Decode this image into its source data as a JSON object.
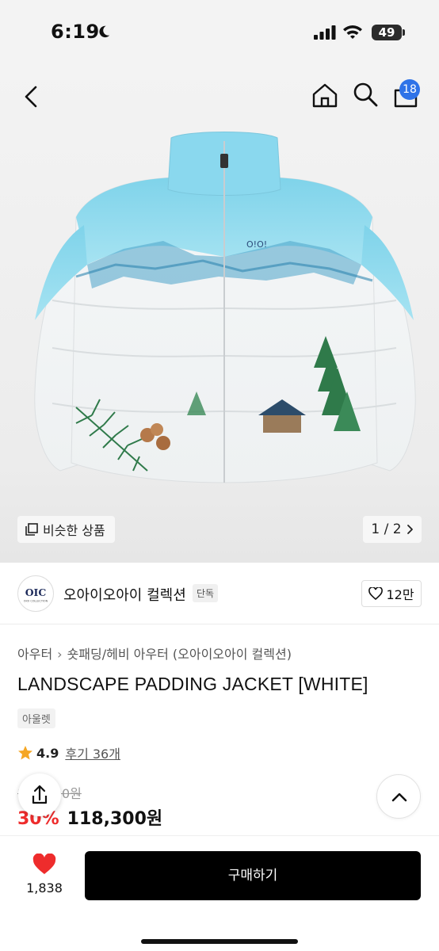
{
  "status_bar": {
    "time": "6:19",
    "battery": "49"
  },
  "header": {
    "cart_count": "18"
  },
  "gallery": {
    "similar_label": "비슷한 상품",
    "pager": "1 / 2"
  },
  "brand": {
    "name": "오아이오아이 컬렉션",
    "tag": "단독",
    "likes": "12만",
    "logo_text": "OIC",
    "logo_subtext": "OIOI COLLECTION"
  },
  "product": {
    "breadcrumb": [
      "아우터",
      "숏패딩/헤비 아우터 (오아이오아이 컬렉션)"
    ],
    "title": "LANDSCAPE PADDING JACKET [WHITE]",
    "tag": "아울렛",
    "rating": "4.9",
    "reviews": "후기 36개",
    "original_price": "169,000원",
    "discount": "30%",
    "sale_price": "118,300원"
  },
  "bottom_bar": {
    "wish_count": "1,838",
    "buy_label": "구매하기"
  },
  "colors": {
    "accent_red": "#ee2c2c",
    "badge_blue": "#2f73e8",
    "star": "#f5a623",
    "button_black": "#000000"
  },
  "icons": [
    "moon-icon",
    "signal-icon",
    "wifi-icon",
    "battery-icon",
    "back-icon",
    "home-icon",
    "search-icon",
    "cart-icon",
    "similar-icon",
    "chevron-right-icon",
    "heart-outline-icon",
    "star-icon",
    "share-icon",
    "chevron-up-icon",
    "heart-filled-icon"
  ]
}
